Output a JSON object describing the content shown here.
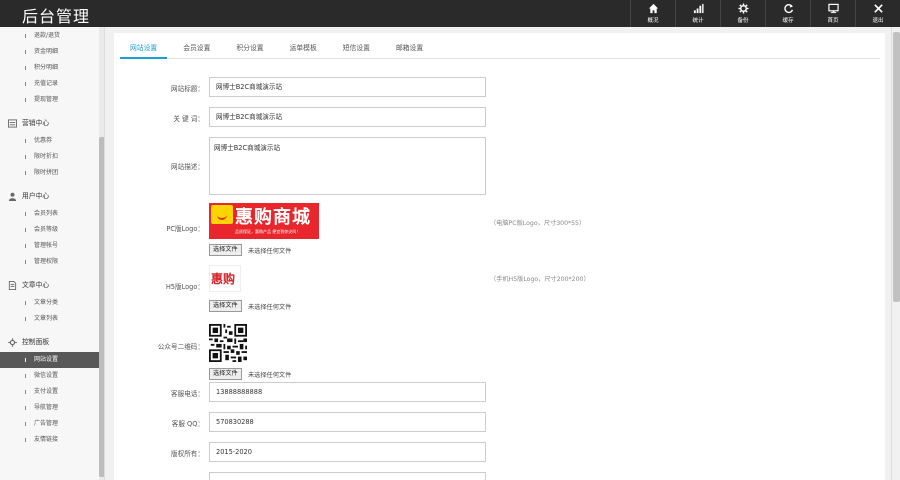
{
  "brand": "后台管理",
  "topnav": [
    {
      "label": "概况",
      "icon": "home-icon"
    },
    {
      "label": "统计",
      "icon": "bar-chart-icon"
    },
    {
      "label": "备份",
      "icon": "gear-icon"
    },
    {
      "label": "缓存",
      "icon": "refresh-icon"
    },
    {
      "label": "首页",
      "icon": "monitor-icon"
    },
    {
      "label": "退出",
      "icon": "close-icon"
    }
  ],
  "sidebar": {
    "top_items": [
      "退款/退货",
      "资金明细",
      "积分明细",
      "充值记录",
      "提现管理"
    ],
    "groups": [
      {
        "title": "营销中心",
        "icon": "marketing-icon",
        "items": [
          "优惠券",
          "限时折扣",
          "限时拼团"
        ]
      },
      {
        "title": "用户中心",
        "icon": "user-icon",
        "items": [
          "会员列表",
          "会员等级",
          "管理帐号",
          "管理权限"
        ]
      },
      {
        "title": "文章中心",
        "icon": "document-icon",
        "items": [
          "文章分类",
          "文章列表"
        ]
      },
      {
        "title": "控制面板",
        "icon": "gear-icon",
        "items": [
          "网站设置",
          "微信设置",
          "支付设置",
          "导航管理",
          "广告管理",
          "友情链接"
        ]
      }
    ],
    "active_item": "网站设置"
  },
  "tabs": [
    "网站设置",
    "会员设置",
    "积分设置",
    "运单模板",
    "短信设置",
    "邮箱设置"
  ],
  "form": {
    "site_title_label": "网站标题：",
    "site_title_value": "网博士B2C商城演示站",
    "keywords_label": "关 键 词：",
    "keywords_value": "网博士B2C商城演示站",
    "description_label": "网站描述：",
    "description_value": "网博士B2C商城演示站",
    "pc_logo_label": "PC版Logo：",
    "pc_logo_text": "惠购商城",
    "pc_logo_sub": "品质保证，惠购产品 便宜到你尖叫！",
    "pc_logo_hint": "（电脑PC版Logo，尺寸300*55）",
    "h5_logo_label": "H5版Logo：",
    "h5_logo_text": "惠购",
    "h5_logo_hint": "（手机H5版Logo，尺寸200*200）",
    "qr_label": "公众号二维码：",
    "file_button": "选择文件",
    "file_none": "未选择任何文件",
    "phone_label": "客服电话：",
    "phone_value": "13888888888",
    "qq_label": "客服 QQ：",
    "qq_value": "570830288",
    "copyright_label": "版权所有：",
    "copyright_value": "2015-2020"
  },
  "colors": {
    "accent": "#1a9ed8",
    "topbar": "#2a2a2a",
    "active_side": "#585858",
    "logo_red": "#e8262c",
    "logo_yellow": "#ffd400"
  }
}
